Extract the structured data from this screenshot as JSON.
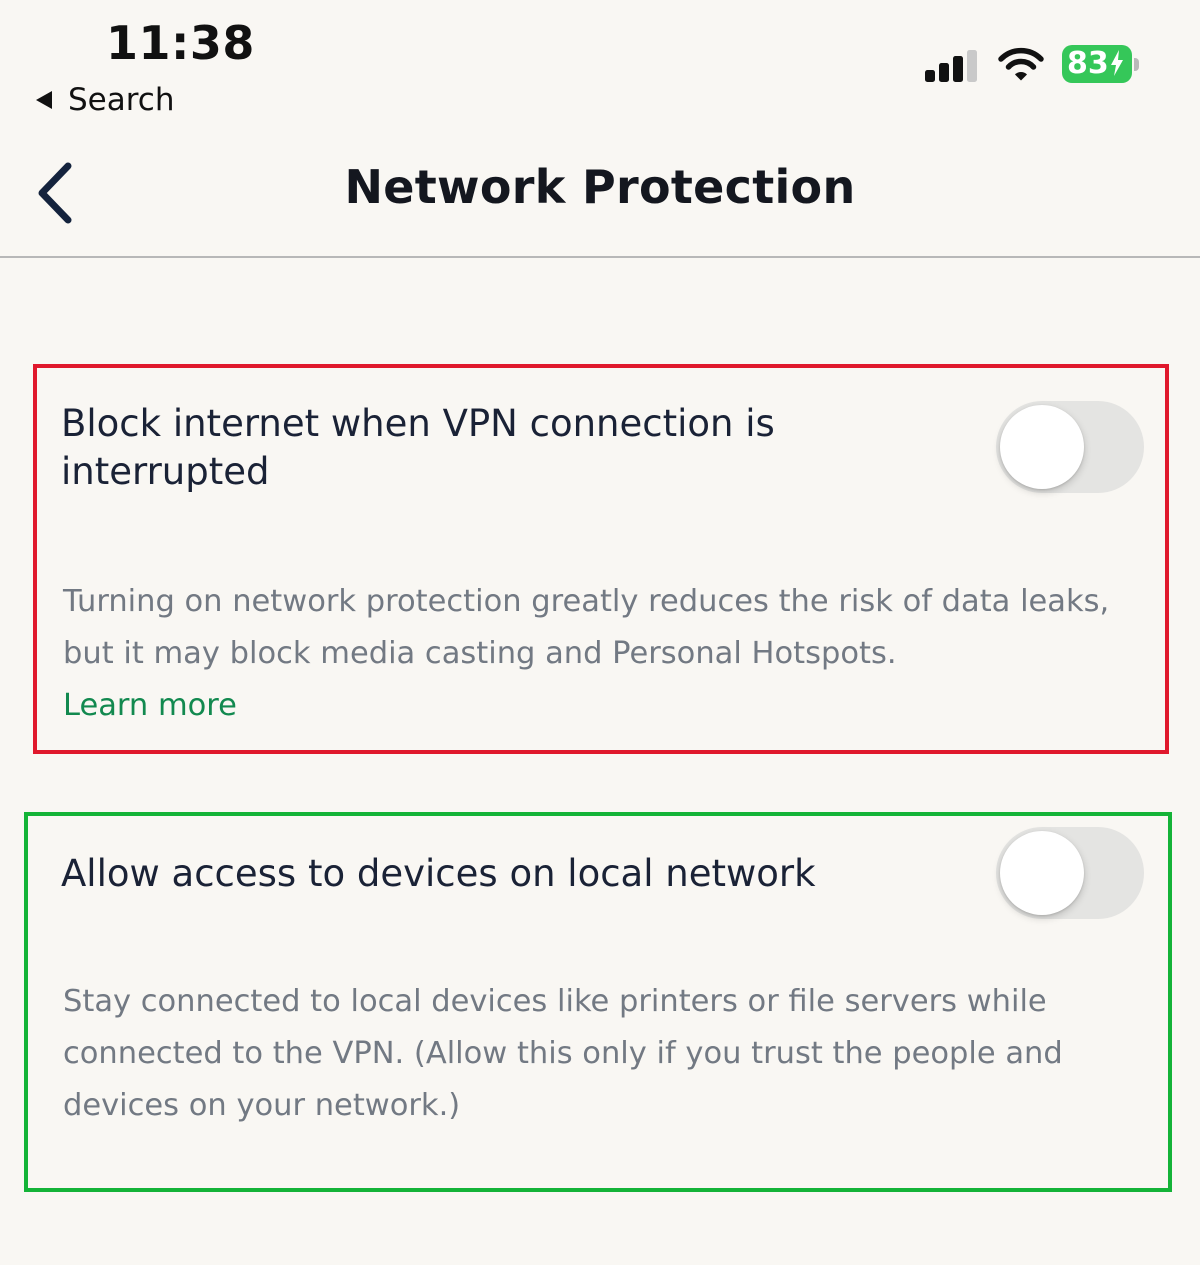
{
  "status_bar": {
    "time": "11:38",
    "back_app_label": "Search",
    "battery_level": "83",
    "battery_color": "#35c759",
    "icons": [
      "cellular-signal-icon",
      "wifi-icon",
      "battery-charging-icon"
    ]
  },
  "nav": {
    "title": "Network Protection",
    "back_icon": "chevron-left-icon"
  },
  "settings": [
    {
      "title": "Block internet when VPN connection is interrupted",
      "description": "Turning on network protection greatly reduces the risk of data leaks, but it may block media casting and Personal Hotspots.",
      "link_label": "Learn more",
      "enabled": false,
      "highlight_color": "#e0182c"
    },
    {
      "title": "Allow access to devices on local network",
      "description": "Stay connected to local devices like printers or file servers while connected to the VPN. (Allow this only if you trust the people and devices on your network.)",
      "enabled": false,
      "highlight_color": "#14b337"
    }
  ],
  "colors": {
    "background": "#f9f7f3",
    "link": "#12894f",
    "toggle_off": "#e4e4e2"
  }
}
